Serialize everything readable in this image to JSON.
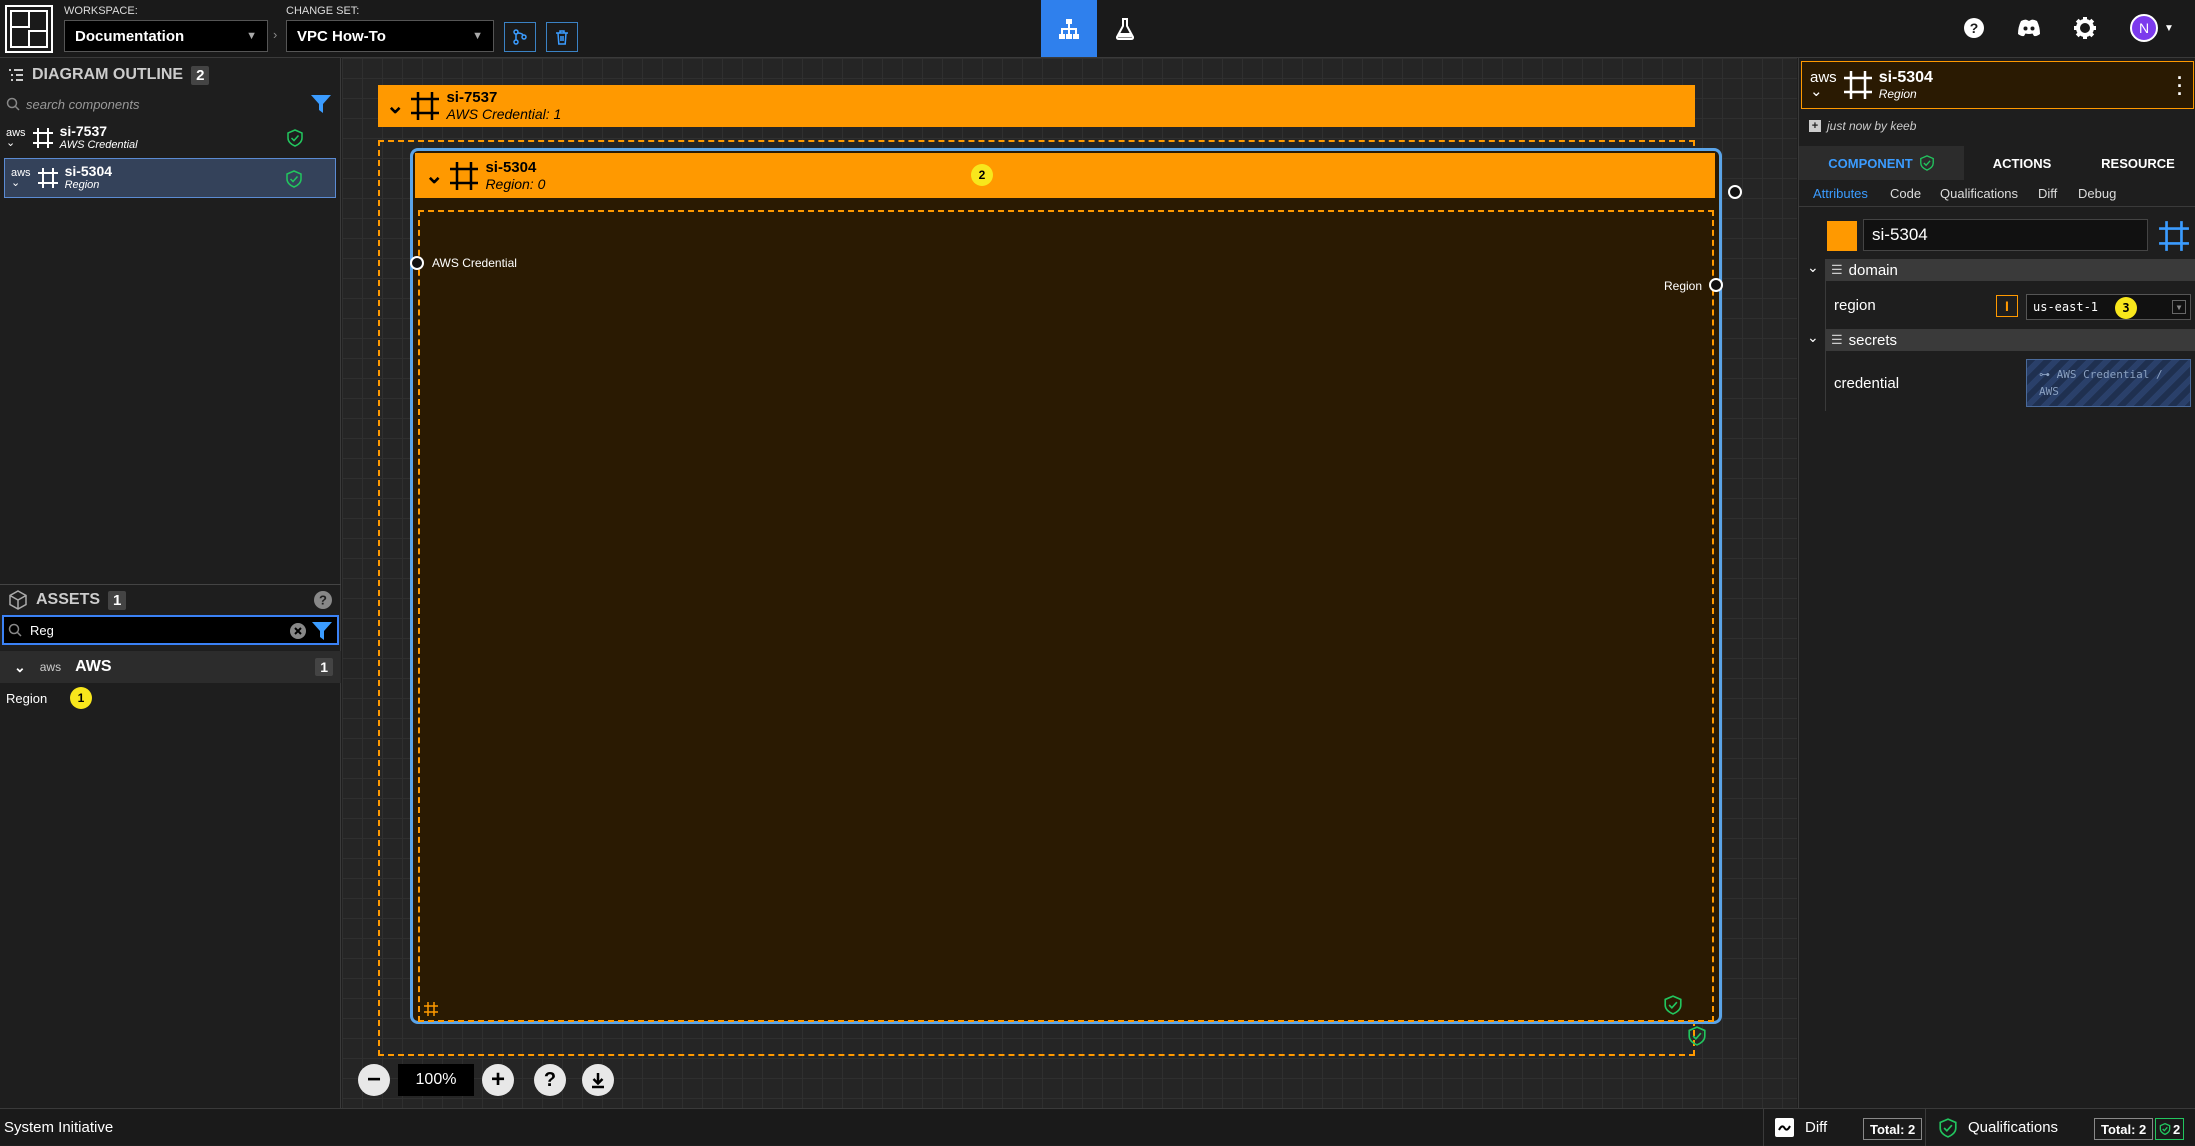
{
  "topbar": {
    "workspace_label": "WORKSPACE:",
    "workspace_value": "Documentation",
    "changeset_label": "CHANGE SET:",
    "changeset_value": "VPC How-To",
    "avatar_initial": "N"
  },
  "outline": {
    "title": "DIAGRAM OUTLINE",
    "count": "2",
    "search_placeholder": "search components",
    "items": [
      {
        "name": "si-7537",
        "type": "AWS Credential",
        "provider": "aws"
      },
      {
        "name": "si-5304",
        "type": "Region",
        "provider": "aws"
      }
    ]
  },
  "assets": {
    "title": "ASSETS",
    "count": "1",
    "search_value": "Reg",
    "group": {
      "name": "AWS",
      "provider": "aws",
      "count": "1"
    },
    "items": [
      {
        "name": "Region",
        "badge": "1"
      }
    ]
  },
  "canvas": {
    "outer_frame": {
      "name": "si-7537",
      "sub": "AWS Credential: 1"
    },
    "inner_frame": {
      "name": "si-5304",
      "sub": "Region: 0",
      "badge": "2"
    },
    "socket_in_label": "AWS Credential",
    "socket_out_label": "Region",
    "zoom": "100%"
  },
  "details": {
    "provider": "aws",
    "name": "si-5304",
    "type": "Region",
    "updated": "just now by keeb",
    "tabs": [
      "COMPONENT",
      "ACTIONS",
      "RESOURCE"
    ],
    "subtabs": [
      "Attributes",
      "Code",
      "Qualifications",
      "Diff",
      "Debug"
    ],
    "name_field_value": "si-5304",
    "accent_color": "#ff9900",
    "sections": [
      {
        "title": "domain",
        "props": [
          {
            "label": "region",
            "value": "us-east-1",
            "badge": "3"
          }
        ]
      },
      {
        "title": "secrets",
        "props": [
          {
            "label": "credential",
            "value": "⊶ AWS Credential / AWS"
          }
        ]
      }
    ]
  },
  "status": {
    "app_name": "System Initiative",
    "diff_label": "Diff",
    "diff_total": "Total: 2",
    "qual_label": "Qualifications",
    "qual_total": "Total: 2",
    "qual_ok": "2"
  },
  "colors": {
    "accent_blue": "#2f80ed",
    "frame_orange": "#ff9900",
    "frame_body": "#2a1a02",
    "success": "#22c55e"
  }
}
